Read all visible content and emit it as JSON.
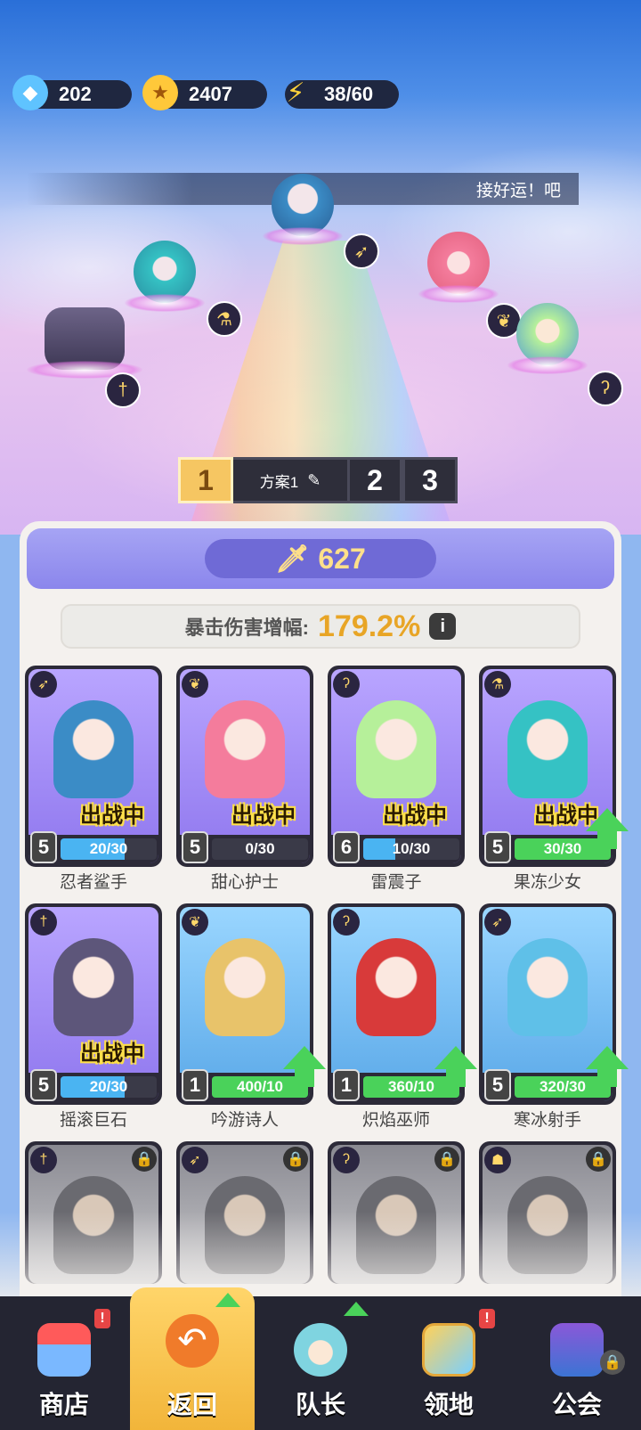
{
  "resources": [
    {
      "icon": "gem-icon",
      "value": "202"
    },
    {
      "icon": "gold-coin-icon",
      "value": "2407"
    },
    {
      "icon": "energy-bolt-icon",
      "value": "38/60"
    }
  ],
  "speech": "接好运！吧",
  "plans": {
    "active": "1",
    "name": "方案1",
    "other": [
      "2",
      "3"
    ]
  },
  "power": "627",
  "crit": {
    "label": "暴击伤害增幅:",
    "value": "179.2%"
  },
  "battle_tag": "出战中",
  "heroes": [
    {
      "name": "忍者鲨手",
      "level": "5",
      "progress": "20/30",
      "fill": 0.67,
      "bg": "purple",
      "deployed": true,
      "upgrade": false,
      "cls": "bow-icon"
    },
    {
      "name": "甜心护士",
      "level": "5",
      "progress": "0/30",
      "fill": 0,
      "bg": "purple",
      "deployed": true,
      "upgrade": false,
      "cls": "wings-icon"
    },
    {
      "name": "雷震子",
      "level": "6",
      "progress": "10/30",
      "fill": 0.33,
      "bg": "purple",
      "deployed": true,
      "upgrade": false,
      "cls": "staff-icon"
    },
    {
      "name": "果冻少女",
      "level": "5",
      "progress": "30/30",
      "fill": 1,
      "bg": "purple",
      "deployed": true,
      "upgrade": true,
      "cls": "potion-icon"
    },
    {
      "name": "摇滚巨石",
      "level": "5",
      "progress": "20/30",
      "fill": 0.67,
      "bg": "purple",
      "deployed": true,
      "upgrade": false,
      "cls": "sword-icon"
    },
    {
      "name": "吟游诗人",
      "level": "1",
      "progress": "400/10",
      "fill": 1,
      "bg": "blue",
      "deployed": false,
      "upgrade": true,
      "cls": "wings-icon"
    },
    {
      "name": "炽焰巫师",
      "level": "1",
      "progress": "360/10",
      "fill": 1,
      "bg": "blue",
      "deployed": false,
      "upgrade": true,
      "cls": "staff-icon"
    },
    {
      "name": "寒冰射手",
      "level": "5",
      "progress": "320/30",
      "fill": 1,
      "bg": "blue",
      "deployed": false,
      "upgrade": true,
      "cls": "bow-icon"
    }
  ],
  "locked_heroes": [
    "sword-icon",
    "bow-icon",
    "staff-icon",
    "beast-icon"
  ],
  "nav": [
    {
      "label": "商店",
      "icon": "shop-icon",
      "alert": "!",
      "active": false
    },
    {
      "label": "返回",
      "icon": "return-icon",
      "active": true,
      "up": true
    },
    {
      "label": "队长",
      "icon": "captain-icon",
      "active": false,
      "up": true
    },
    {
      "label": "领地",
      "icon": "territory-icon",
      "alert": "!",
      "active": false
    },
    {
      "label": "公会",
      "icon": "guild-icon",
      "active": false,
      "locked": true
    }
  ],
  "colors": {
    "gold": "#e8a526",
    "green": "#4ad25a",
    "purple_card": "#9b85f2",
    "blue_card": "#6bb6f0"
  }
}
